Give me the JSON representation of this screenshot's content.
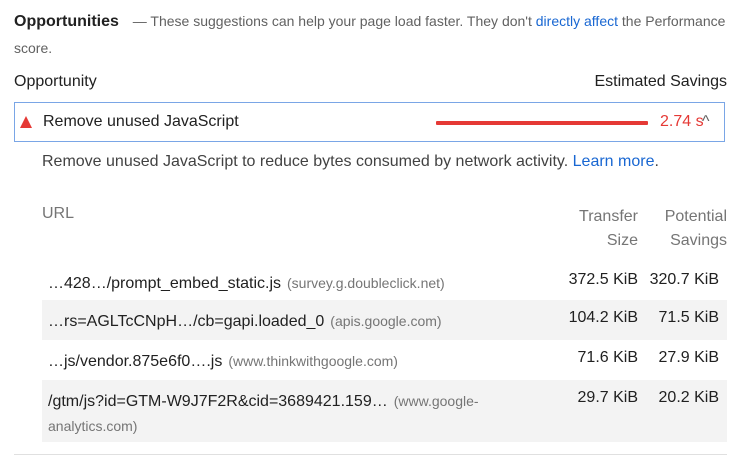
{
  "header": {
    "title": "Opportunities",
    "dash": "—",
    "text_before_link": "These suggestions can help your page load faster. They don't",
    "link": "directly affect",
    "text_after_link": "the Performance score."
  },
  "columns": {
    "opportunity": "Opportunity",
    "estimated_savings": "Estimated Savings"
  },
  "opportunity": {
    "title": "Remove unused JavaScript",
    "savings": "2.74 s",
    "savings_fraction": 1.0,
    "chevron": "^",
    "status_color": "#e53935",
    "icon": "warning-triangle-icon"
  },
  "description": {
    "text": "Remove unused JavaScript to reduce bytes consumed by network activity.",
    "link": "Learn more",
    "trailing": "."
  },
  "table": {
    "headers": {
      "url": "URL",
      "transfer_line1": "Transfer",
      "transfer_line2": "Size",
      "potential_line1": "Potential",
      "potential_line2": "Savings"
    },
    "rows": [
      {
        "url": "…428…/prompt_embed_static.js",
        "origin": "(survey.g.doubleclick.net)",
        "size": "372.5 KiB",
        "wasted": "320.7 KiB"
      },
      {
        "url": "…rs=AGLTcCNpH…/cb=gapi.loaded_0",
        "origin": "(apis.google.com)",
        "size": "104.2 KiB",
        "wasted": "71.5 KiB"
      },
      {
        "url": "…js/vendor.875e6f0….js",
        "origin": "(www.thinkwithgoogle.com)",
        "size": "71.6 KiB",
        "wasted": "27.9 KiB"
      },
      {
        "url": "/gtm/js?id=GTM-W9J7F2R&cid=3689421.159…",
        "origin": "(www.google-analytics.com)",
        "size": "29.7 KiB",
        "wasted": "20.2 KiB"
      }
    ]
  }
}
